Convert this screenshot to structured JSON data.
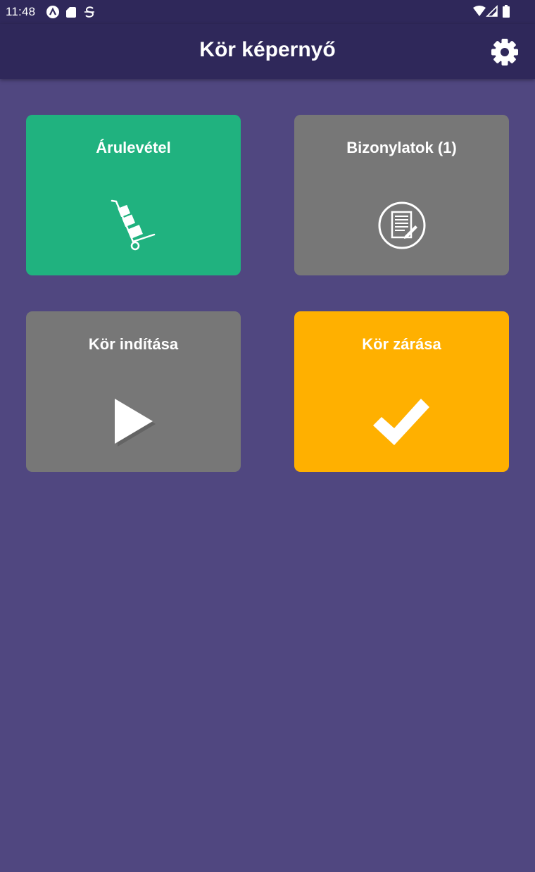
{
  "status_bar": {
    "time": "11:48",
    "left_icons": [
      "android-auto-icon",
      "sd-card-icon",
      "s-app-icon"
    ],
    "right_icons": [
      "wifi-icon",
      "signal-icon",
      "battery-icon"
    ]
  },
  "app_bar": {
    "title": "Kör képernyő",
    "settings_icon": "gear-icon"
  },
  "tiles": [
    {
      "label": "Árulevétel",
      "icon": "hand-truck-icon",
      "color": "#20b27f"
    },
    {
      "label": "Bizonylatok (1)",
      "icon": "document-edit-icon",
      "color": "#777777"
    },
    {
      "label": "Kör indítása",
      "icon": "play-icon",
      "color": "#777777"
    },
    {
      "label": "Kör zárása",
      "icon": "checkmark-icon",
      "color": "#ffb000"
    }
  ],
  "colors": {
    "background": "#504780",
    "app_bar": "#2f285a"
  }
}
